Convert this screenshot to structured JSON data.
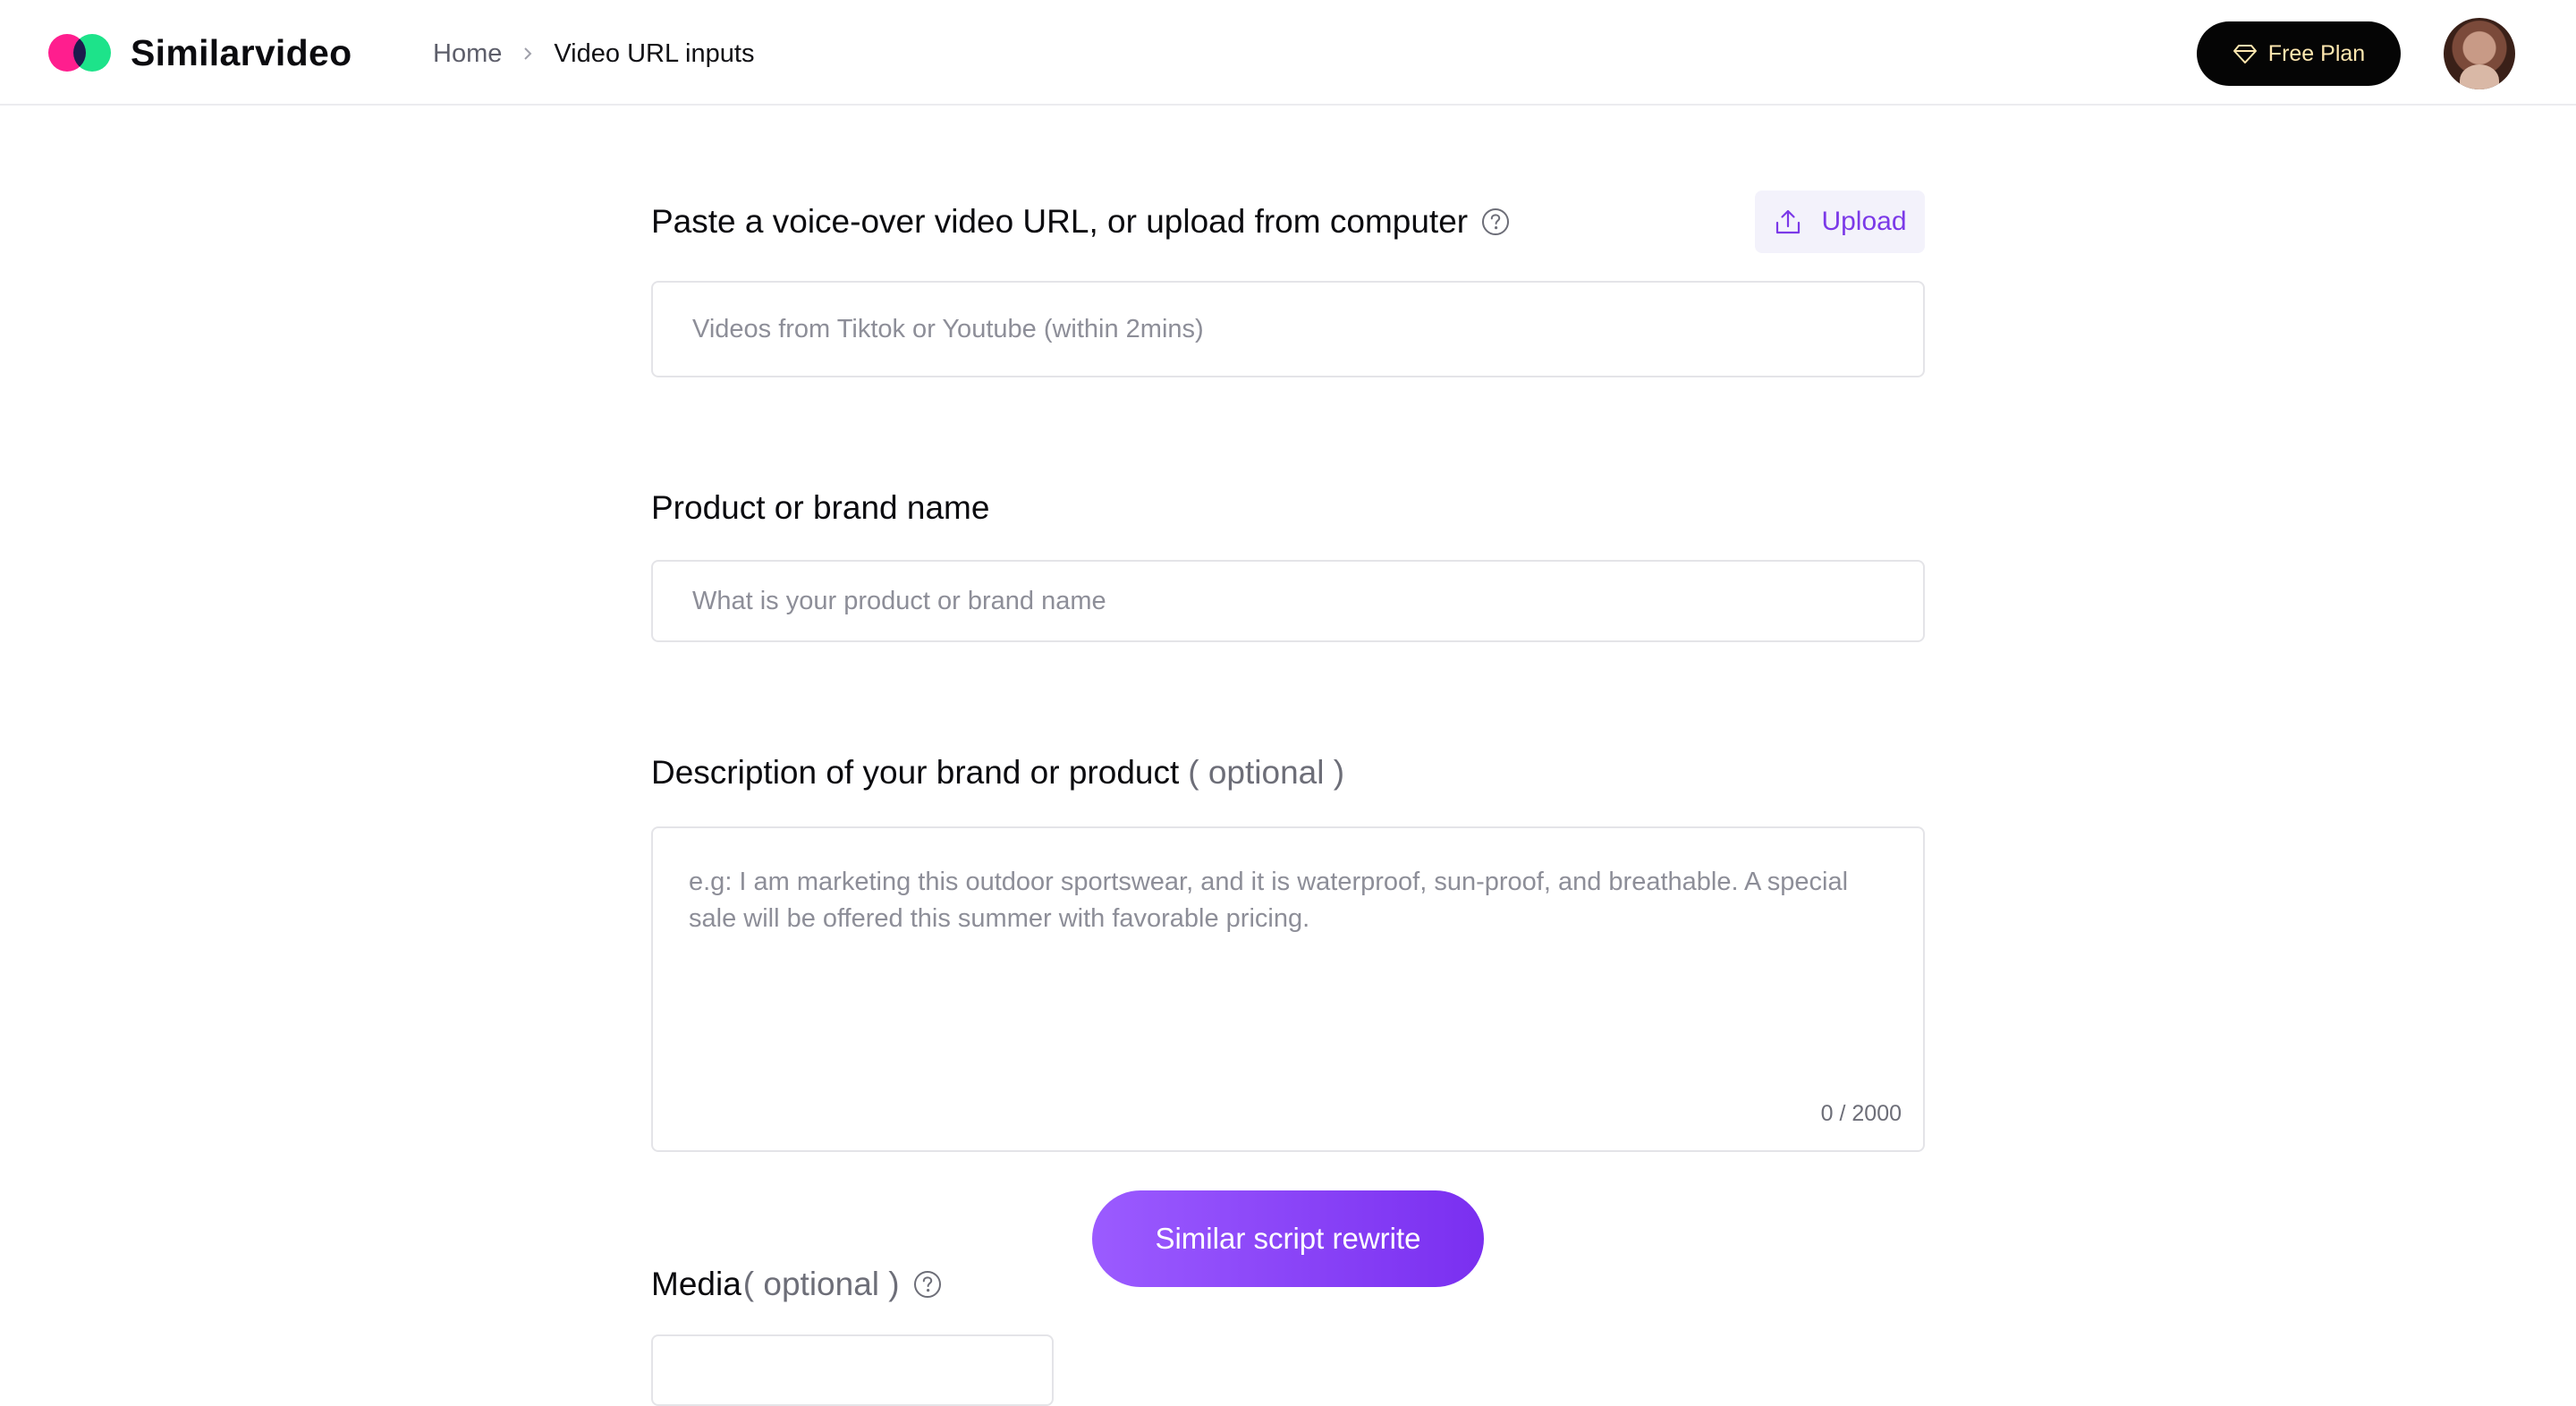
{
  "app": {
    "brand": "Similarvideo"
  },
  "breadcrumb": {
    "home": "Home",
    "current": "Video URL inputs"
  },
  "header": {
    "plan_label": "Free Plan"
  },
  "url_section": {
    "label": "Paste a voice-over video URL, or upload from computer",
    "upload_label": "Upload",
    "placeholder": "Videos from Tiktok or Youtube (within 2mins)",
    "value": ""
  },
  "name_section": {
    "label": "Product or brand name",
    "placeholder": "What is your product or brand name",
    "value": ""
  },
  "desc_section": {
    "label": "Description of your brand or product",
    "optional": "( optional )",
    "placeholder": "e.g: I am marketing this outdoor sportswear, and it is waterproof, sun-proof, and breathable. A special sale will be offered this summer with favorable pricing.",
    "value": "",
    "counter": "0 / 2000"
  },
  "media_section": {
    "label": "Media",
    "optional": "( optional )"
  },
  "actions": {
    "submit_label": "Similar script rewrite"
  },
  "colors": {
    "accent": "#7b39e8",
    "logo_pink": "#ff1e8e",
    "logo_green": "#1de38a"
  },
  "icons": {
    "help": "question-circle-icon",
    "upload": "upload-icon",
    "plan": "diamond-icon",
    "breadcrumb_separator": "chevron-right-icon"
  }
}
